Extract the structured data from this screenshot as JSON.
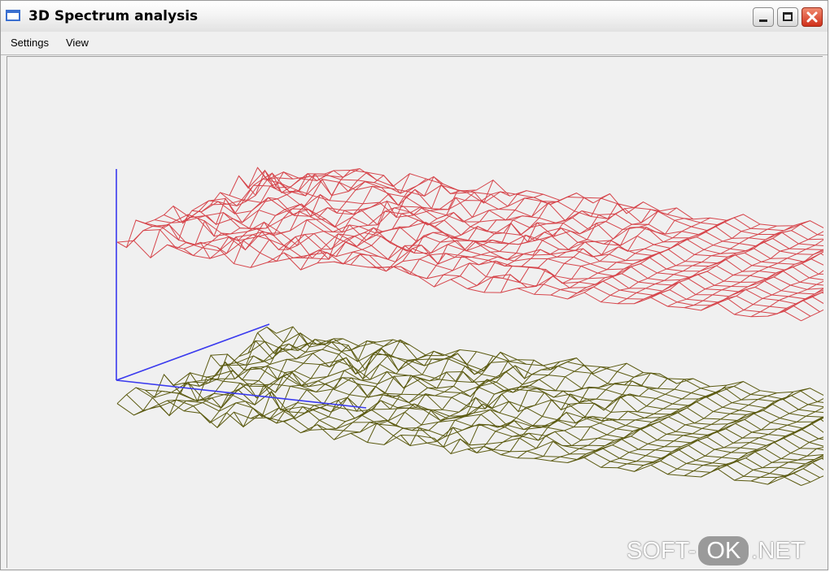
{
  "window": {
    "title": "3D Spectrum analysis"
  },
  "titlebar": {
    "icons": [
      "window-app-icon",
      "minimize-icon",
      "maximize-icon",
      "close-icon"
    ]
  },
  "menu": {
    "items": [
      {
        "label": "Settings"
      },
      {
        "label": "View"
      }
    ]
  },
  "plot": {
    "surfaces": [
      {
        "color": "#d6454b"
      },
      {
        "color": "#5b5a10"
      }
    ],
    "axis_color": "#3a3aee"
  },
  "watermark": {
    "left": "SOFT-",
    "middle": "OK",
    "right": ".NET"
  }
}
